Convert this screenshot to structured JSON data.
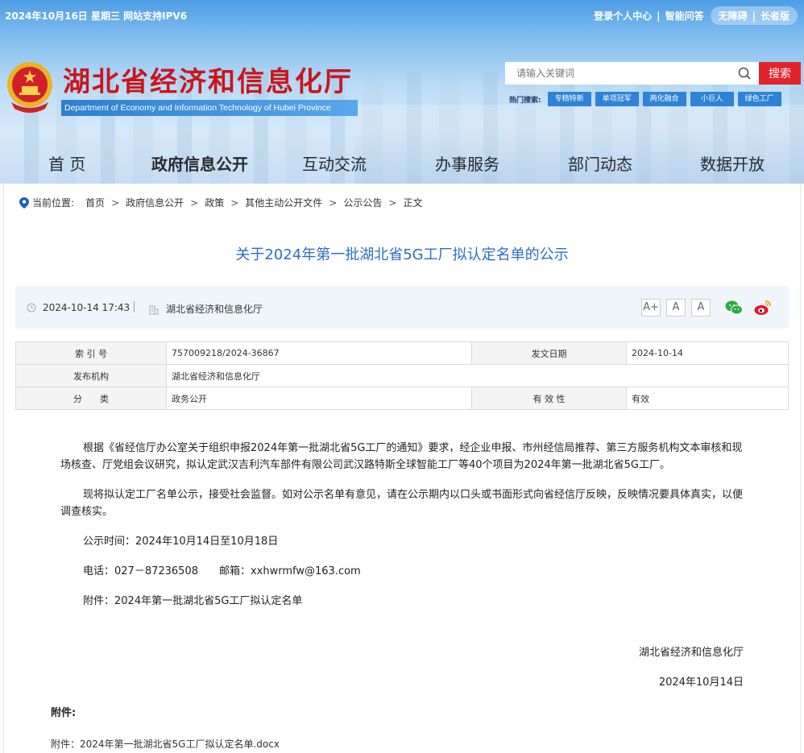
{
  "topbar": {
    "date_text": "2024年10月16日 星期三  网站支持IPV6",
    "login": "登录个人中心",
    "qa": "智能问答",
    "accessible": "无障碍",
    "elder": "长者版"
  },
  "site": {
    "title": "湖北省经济和信息化厅",
    "subtitle": "Department of Economy and Information Technology of Hubei Province"
  },
  "search": {
    "placeholder": "请输入关键词",
    "button": "搜索",
    "hot_label": "热门搜索:",
    "hot_tags": [
      "专精特新",
      "单项冠军",
      "两化融合",
      "小巨人",
      "绿色工厂"
    ]
  },
  "nav": [
    "首 页",
    "政府信息公开",
    "互动交流",
    "办事服务",
    "部门动态",
    "数据开放"
  ],
  "breadcrumb": {
    "label": "当前位置:",
    "items": [
      "首页",
      "政府信息公开",
      "政策",
      "其他主动公开文件",
      "公示公告",
      "正文"
    ]
  },
  "article": {
    "title": "关于2024年第一批湖北省5G工厂拟认定名单的公示",
    "datetime": "2024-10-14 17:43",
    "source": "湖北省经济和信息化厅",
    "font_buttons": [
      "A+",
      "A",
      "A"
    ]
  },
  "info_table": {
    "index_label": "索 引 号",
    "index_value": "757009218/2024-36867",
    "date_label": "发文日期",
    "date_value": "2024-10-14",
    "org_label": "发布机构",
    "org_value": "湖北省经济和信息化厅",
    "cat_label": "分　　类",
    "cat_value": "政务公开",
    "valid_label": "有 效 性",
    "valid_value": "有效"
  },
  "body": {
    "p1": "根据《省经信厅办公室关于组织申报2024年第一批湖北省5G工厂的通知》要求，经企业申报、市州经信局推荐、第三方服务机构文本审核和现场核查、厅党组会议研究，拟认定武汉吉利汽车部件有限公司武汉路特斯全球智能工厂等40个项目为2024年第一批湖北省5G工厂。",
    "p2": "现将拟认定工厂名单公示，接受社会监督。如对公示名单有意见，请在公示期内以口头或书面形式向省经信厅反映，反映情况要具体真实，以便调查核实。",
    "p3": "公示时间：2024年10月14日至10月18日",
    "p4": "电话：027－87236508　　邮箱：xxhwrmfw@163.com",
    "p5": "附件：2024年第一批湖北省5G工厂拟认定名单",
    "sign_org": "湖北省经济和信息化厅",
    "sign_date": "2024年10月14日"
  },
  "attachment": {
    "heading": "附件:",
    "file": "附件：2024年第一批湖北省5G工厂拟认定名单.docx"
  }
}
